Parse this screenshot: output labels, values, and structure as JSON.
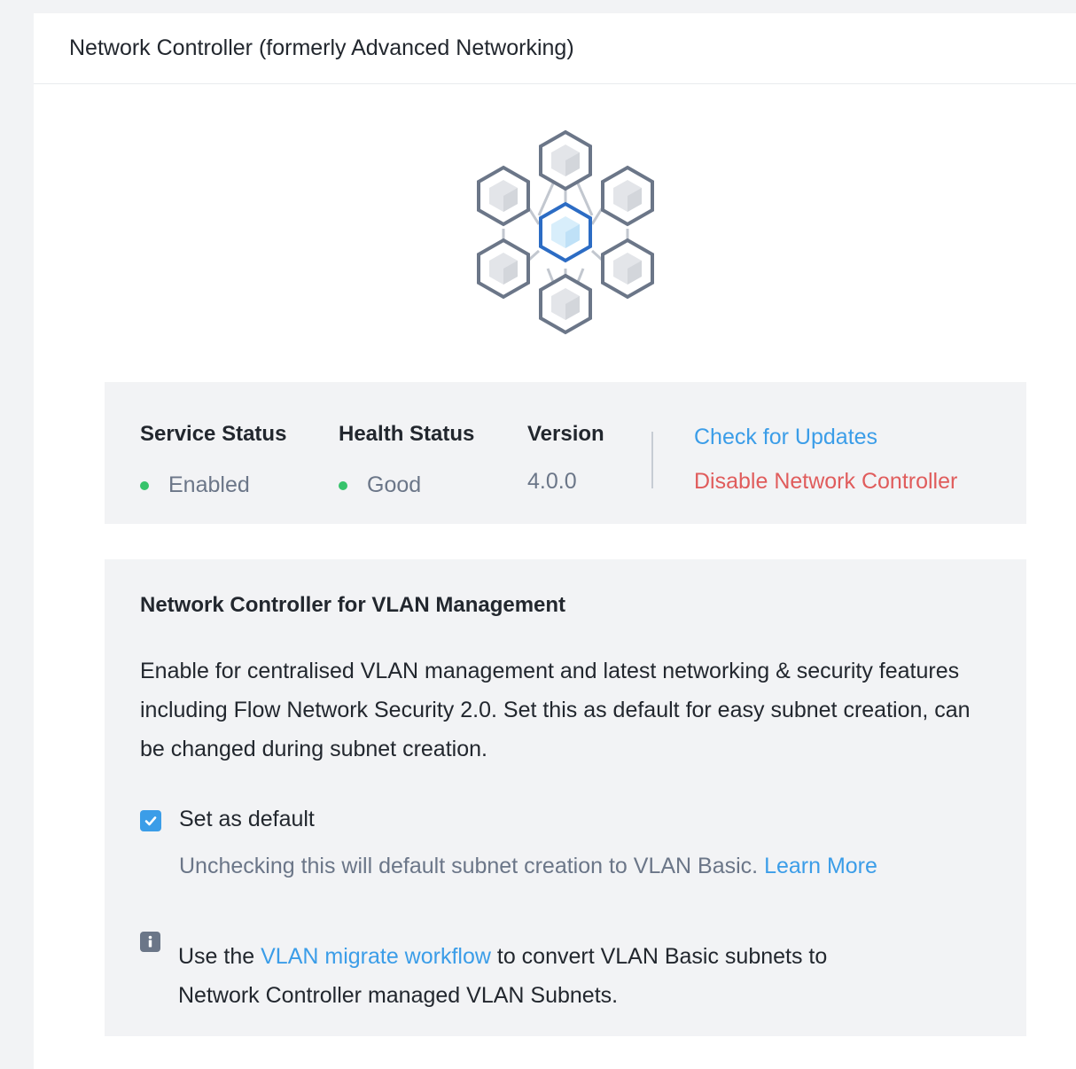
{
  "panel": {
    "title": "Network Controller (formerly Advanced Networking)"
  },
  "hero": {
    "icon": "hexagon-cube-network-icon"
  },
  "status": {
    "service_label": "Service Status",
    "service_value": "Enabled",
    "health_label": "Health Status",
    "health_value": "Good",
    "version_label": "Version",
    "version_value": "4.0.0",
    "check_updates_label": "Check for Updates",
    "disable_label": "Disable Network Controller"
  },
  "vlan": {
    "title": "Network Controller for VLAN Management",
    "description": "Enable for centralised VLAN management and latest networking & security features including Flow Network Security 2.0. Set this as default for easy subnet creation, can be changed during subnet creation.",
    "set_default_label": "Set as default",
    "set_default_checked": true,
    "help_text": "Unchecking this will default subnet creation to VLAN Basic. ",
    "learn_more_label": "Learn More",
    "info_prefix": "Use the ",
    "info_link_label": "VLAN migrate workflow",
    "info_suffix_line1": " to convert VLAN Basic subnets to",
    "info_line2": "Network Controller managed VLAN Subnets."
  },
  "colors": {
    "page_bg": "#f2f3f5",
    "panel_bg": "#ffffff",
    "accent_blue": "#3b9de8",
    "danger_red": "#e05c5c",
    "status_green": "#36c36b",
    "muted_text": "#6b7688"
  }
}
